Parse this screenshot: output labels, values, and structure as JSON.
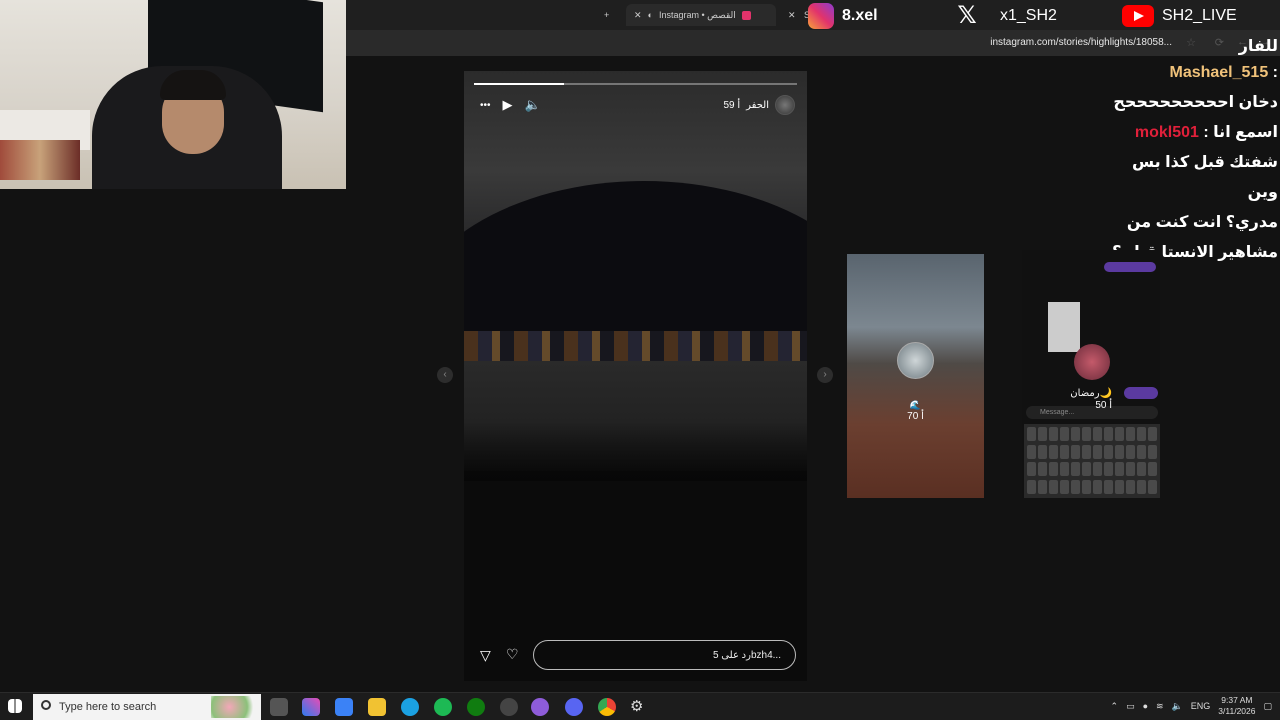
{
  "browser": {
    "tabs": [
      {
        "label": "Instagram • القصص",
        "active": true
      },
      {
        "label": "S",
        "active": false
      }
    ],
    "new_tab": "+",
    "url": "instagram.com/stories/highlights/18058..."
  },
  "story": {
    "username": "الحفر",
    "age": "59 أ",
    "progress": 0.28,
    "reply_placeholder": "رد على 5bzh4...",
    "more_label": "•••"
  },
  "next_story": {
    "count": "70 أ",
    "emoji": "🌊"
  },
  "kb_story": {
    "username": "رمضان🌙",
    "age": "50 أ",
    "message_placeholder": "Message..."
  },
  "social": {
    "instagram": "8.xel",
    "x": "x1_SH2",
    "youtube": "SH2_LIVE"
  },
  "chat": {
    "line0": "للفار",
    "user1": "Mashael_515",
    "line1": "دخان احححححححححح",
    "line2a": "اسمع انا",
    "user2": "mokl501",
    "line3": "شفتك قبل كذا بس وين",
    "line4": "مدري؟ انت كنت من",
    "line5": "مشاهير الانستا قبل ؟"
  },
  "taskbar": {
    "search_placeholder": "Type here to search",
    "lang": "ENG",
    "time": "9:37 AM",
    "date": "3/11/2026"
  },
  "colors": {
    "ig_gradient": [
      "#f9a23a",
      "#e2336b",
      "#8b3bd0"
    ],
    "youtube_red": "#ff0000",
    "chat_user1": "#f0c27a",
    "chat_user2": "#e0203a"
  }
}
